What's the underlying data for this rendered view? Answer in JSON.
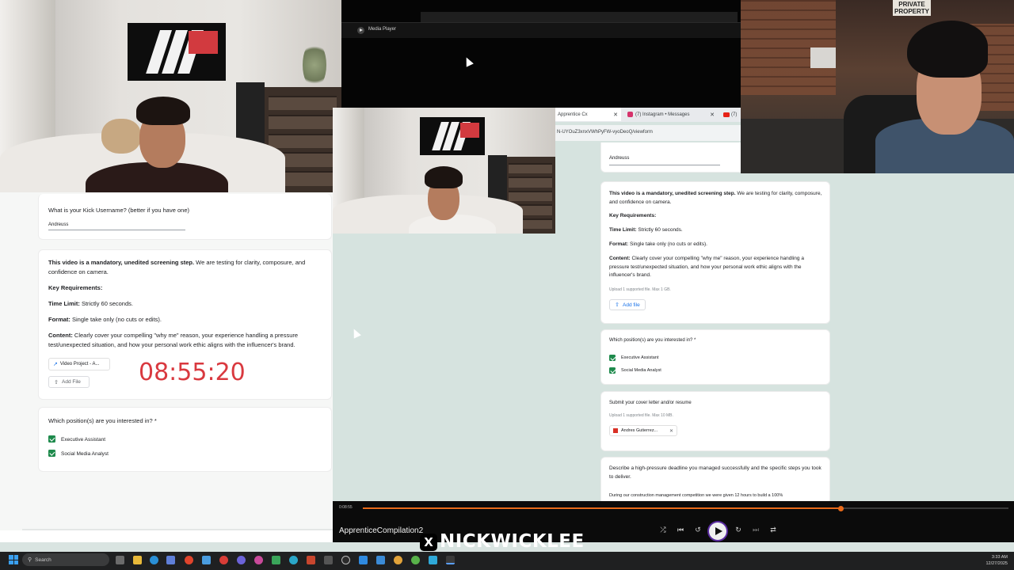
{
  "media_player": {
    "window_title": "Media Player",
    "video_title": "ApprenticeCompilation2",
    "elapsed": "0:08:55",
    "progress": 0.74
  },
  "browser": {
    "tabs": [
      "Apprentice Cx",
      "(7) Instagram • Messages",
      "(7)"
    ],
    "url": "N-UYOuZ3xnxVWhPyFW-vyoDeoQ/viewform"
  },
  "left_form": {
    "username_question": "What is your Kick Username? (better if you have one)",
    "username_answer": "Andreuss",
    "video_intro_bold": "This video is a mandatory, unedited screening step.",
    "video_intro_rest": " We are testing for clarity, composure, and confidence on camera.",
    "key_requirements": "Key Requirements:",
    "time_limit_label": "Time Limit:",
    "time_limit_value": " Strictly 60 seconds.",
    "format_label": "Format:",
    "format_value": " Single take only (no cuts or edits).",
    "content_label": "Content:",
    "content_value": " Clearly cover your compelling \"why me\" reason, your experience handling a pressure test/unexpected situation, and how your personal work ethic aligns with the influencer's brand.",
    "attached_file": "Video Project - A...",
    "add_file": "Add File",
    "timer": "08:55:20",
    "positions_question": "Which position(s) are you interested in? *",
    "positions": [
      "Executive Assistant",
      "Social Media Analyst"
    ]
  },
  "right_form": {
    "username_answer": "Andreuss",
    "video_intro_bold": "This video is a mandatory, unedited screening step.",
    "video_intro_rest": " We are testing for clarity, composure, and confidence on camera.",
    "key_requirements": "Key Requirements:",
    "time_limit_label": "Time Limit:",
    "time_limit_value": " Strictly 60 seconds.",
    "format_label": "Format:",
    "format_value": " Single take only (no cuts or edits).",
    "content_label": "Content:",
    "content_value": " Clearly cover your compelling \"why me\" reason, your experience handling a pressure test/unexpected situation, and how your personal work ethic aligns with the influencer's brand.",
    "upload_hint": "Upload 1 supported file. Max 1 GB.",
    "add_file": "Add file",
    "positions_question": "Which position(s) are you interested in? *",
    "positions": [
      "Executive Assistant",
      "Social Media Analyst"
    ],
    "cover_letter_question": "Submit your cover letter and/or resume",
    "cover_letter_hint": "Upload 1 supported file. Max 10 MB.",
    "resume_file": "Andres Gutierrez...",
    "deadline_question": "Describe a high-pressure deadline you managed successfully and the specific steps you took to deliver.",
    "deadline_answer": "During our construction management competition we were given 12 hours to build a 100%"
  },
  "studio_sign": "PRIVATE PROPERTY",
  "watermark": {
    "x_glyph": "X",
    "handle": "NICKWICKLEE"
  },
  "taskbar": {
    "search_placeholder": "Search",
    "time": "3:33 AM",
    "date": "12/27/2025"
  },
  "colors": {
    "timer_red": "#d9393f",
    "checkbox_green": "#1e8a4c",
    "seek_orange": "#e86a1a",
    "form_background": "#d9e4e1"
  },
  "icons": [
    "windows-icon",
    "search-icon",
    "upload-icon",
    "file-icon",
    "pdf-icon",
    "play-icon",
    "close-icon",
    "checkbox-checked-icon"
  ]
}
